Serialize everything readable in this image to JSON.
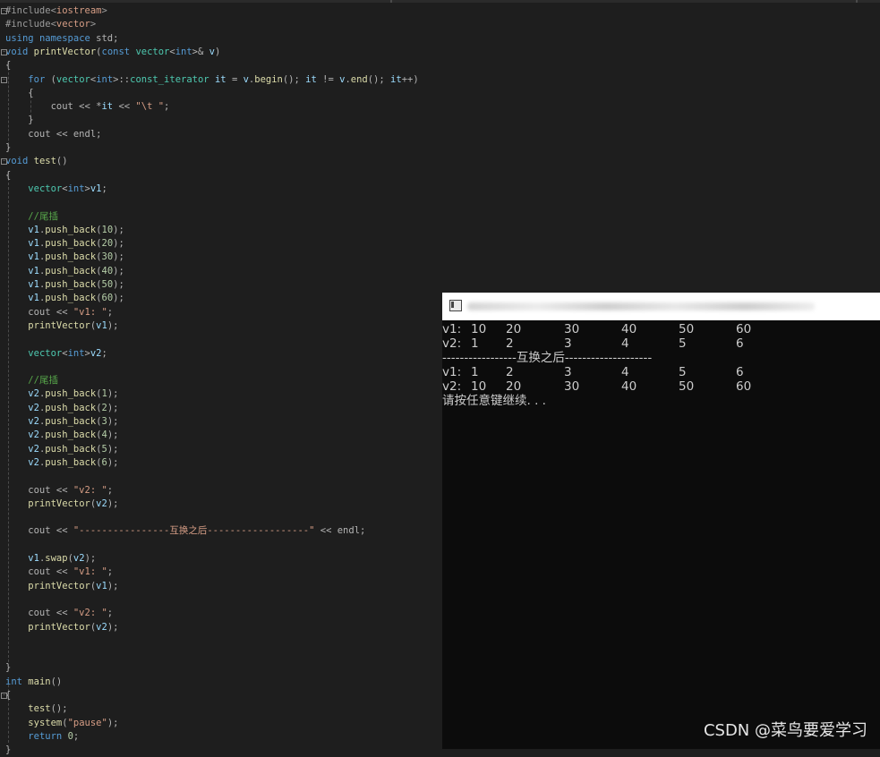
{
  "editor": {
    "code": [
      {
        "t": "pp",
        "v": "#include<"
      },
      {
        "t": "inc",
        "v": "iostream"
      },
      {
        "t": "pp",
        "v": ">"
      }
    ]
  },
  "lines": [
    [
      [
        "pp",
        "#include<"
      ],
      [
        "inc",
        "iostream"
      ],
      [
        "pp",
        ">"
      ]
    ],
    [
      [
        "pp",
        "#include<"
      ],
      [
        "inc",
        "vector"
      ],
      [
        "pp",
        ">"
      ]
    ],
    [
      [
        "kw",
        "using"
      ],
      [
        "op",
        " "
      ],
      [
        "kw",
        "namespace"
      ],
      [
        "op",
        " std;"
      ]
    ],
    [
      [
        "kw",
        "void"
      ],
      [
        "op",
        " "
      ],
      [
        "fn",
        "printVector"
      ],
      [
        "op",
        "("
      ],
      [
        "kw",
        "const"
      ],
      [
        "op",
        " "
      ],
      [
        "ty",
        "vector"
      ],
      [
        "op",
        "<"
      ],
      [
        "kw",
        "int"
      ],
      [
        "op",
        ">& "
      ],
      [
        "var",
        "v"
      ],
      [
        "op",
        ")"
      ]
    ],
    [
      [
        "op",
        "{"
      ]
    ],
    [
      [
        "op",
        "    "
      ],
      [
        "kw",
        "for"
      ],
      [
        "op",
        " ("
      ],
      [
        "ty",
        "vector"
      ],
      [
        "op",
        "<"
      ],
      [
        "kw",
        "int"
      ],
      [
        "op",
        ">::"
      ],
      [
        "ty",
        "const_iterator"
      ],
      [
        "op",
        " "
      ],
      [
        "var",
        "it"
      ],
      [
        "op",
        " = "
      ],
      [
        "var",
        "v"
      ],
      [
        "op",
        "."
      ],
      [
        "fn",
        "begin"
      ],
      [
        "op",
        "(); "
      ],
      [
        "var",
        "it"
      ],
      [
        "op",
        " != "
      ],
      [
        "var",
        "v"
      ],
      [
        "op",
        "."
      ],
      [
        "fn",
        "end"
      ],
      [
        "op",
        "(); "
      ],
      [
        "var",
        "it"
      ],
      [
        "op",
        "++)"
      ]
    ],
    [
      [
        "op",
        "    {"
      ]
    ],
    [
      [
        "op",
        "        cout << *"
      ],
      [
        "var",
        "it"
      ],
      [
        "op",
        " << "
      ],
      [
        "str",
        "\"\\t \""
      ],
      [
        "op",
        ";"
      ]
    ],
    [
      [
        "op",
        "    }"
      ]
    ],
    [
      [
        "op",
        "    cout << endl;"
      ]
    ],
    [
      [
        "op",
        "}"
      ]
    ],
    [
      [
        "kw",
        "void"
      ],
      [
        "op",
        " "
      ],
      [
        "fn",
        "test"
      ],
      [
        "op",
        "()"
      ]
    ],
    [
      [
        "op",
        "{"
      ]
    ],
    [
      [
        "op",
        "    "
      ],
      [
        "ty",
        "vector"
      ],
      [
        "op",
        "<"
      ],
      [
        "kw",
        "int"
      ],
      [
        "op",
        ">"
      ],
      [
        "var",
        "v1"
      ],
      [
        "op",
        ";"
      ]
    ],
    [
      [
        "op",
        ""
      ]
    ],
    [
      [
        "op",
        "    "
      ],
      [
        "cm",
        "//尾插"
      ]
    ],
    [
      [
        "op",
        "    "
      ],
      [
        "var",
        "v1"
      ],
      [
        "op",
        "."
      ],
      [
        "fn",
        "push_back"
      ],
      [
        "op",
        "("
      ],
      [
        "num",
        "10"
      ],
      [
        "op",
        ");"
      ]
    ],
    [
      [
        "op",
        "    "
      ],
      [
        "var",
        "v1"
      ],
      [
        "op",
        "."
      ],
      [
        "fn",
        "push_back"
      ],
      [
        "op",
        "("
      ],
      [
        "num",
        "20"
      ],
      [
        "op",
        ");"
      ]
    ],
    [
      [
        "op",
        "    "
      ],
      [
        "var",
        "v1"
      ],
      [
        "op",
        "."
      ],
      [
        "fn",
        "push_back"
      ],
      [
        "op",
        "("
      ],
      [
        "num",
        "30"
      ],
      [
        "op",
        ");"
      ]
    ],
    [
      [
        "op",
        "    "
      ],
      [
        "var",
        "v1"
      ],
      [
        "op",
        "."
      ],
      [
        "fn",
        "push_back"
      ],
      [
        "op",
        "("
      ],
      [
        "num",
        "40"
      ],
      [
        "op",
        ");"
      ]
    ],
    [
      [
        "op",
        "    "
      ],
      [
        "var",
        "v1"
      ],
      [
        "op",
        "."
      ],
      [
        "fn",
        "push_back"
      ],
      [
        "op",
        "("
      ],
      [
        "num",
        "50"
      ],
      [
        "op",
        ");"
      ]
    ],
    [
      [
        "op",
        "    "
      ],
      [
        "var",
        "v1"
      ],
      [
        "op",
        "."
      ],
      [
        "fn",
        "push_back"
      ],
      [
        "op",
        "("
      ],
      [
        "num",
        "60"
      ],
      [
        "op",
        ");"
      ]
    ],
    [
      [
        "op",
        "    cout << "
      ],
      [
        "str",
        "\"v1: \""
      ],
      [
        "op",
        ";"
      ]
    ],
    [
      [
        "op",
        "    "
      ],
      [
        "fn",
        "printVector"
      ],
      [
        "op",
        "("
      ],
      [
        "var",
        "v1"
      ],
      [
        "op",
        ");"
      ]
    ],
    [
      [
        "op",
        ""
      ]
    ],
    [
      [
        "op",
        "    "
      ],
      [
        "ty",
        "vector"
      ],
      [
        "op",
        "<"
      ],
      [
        "kw",
        "int"
      ],
      [
        "op",
        ">"
      ],
      [
        "var",
        "v2"
      ],
      [
        "op",
        ";"
      ]
    ],
    [
      [
        "op",
        ""
      ]
    ],
    [
      [
        "op",
        "    "
      ],
      [
        "cm",
        "//尾插"
      ]
    ],
    [
      [
        "op",
        "    "
      ],
      [
        "var",
        "v2"
      ],
      [
        "op",
        "."
      ],
      [
        "fn",
        "push_back"
      ],
      [
        "op",
        "("
      ],
      [
        "num",
        "1"
      ],
      [
        "op",
        ");"
      ]
    ],
    [
      [
        "op",
        "    "
      ],
      [
        "var",
        "v2"
      ],
      [
        "op",
        "."
      ],
      [
        "fn",
        "push_back"
      ],
      [
        "op",
        "("
      ],
      [
        "num",
        "2"
      ],
      [
        "op",
        ");"
      ]
    ],
    [
      [
        "op",
        "    "
      ],
      [
        "var",
        "v2"
      ],
      [
        "op",
        "."
      ],
      [
        "fn",
        "push_back"
      ],
      [
        "op",
        "("
      ],
      [
        "num",
        "3"
      ],
      [
        "op",
        ");"
      ]
    ],
    [
      [
        "op",
        "    "
      ],
      [
        "var",
        "v2"
      ],
      [
        "op",
        "."
      ],
      [
        "fn",
        "push_back"
      ],
      [
        "op",
        "("
      ],
      [
        "num",
        "4"
      ],
      [
        "op",
        ");"
      ]
    ],
    [
      [
        "op",
        "    "
      ],
      [
        "var",
        "v2"
      ],
      [
        "op",
        "."
      ],
      [
        "fn",
        "push_back"
      ],
      [
        "op",
        "("
      ],
      [
        "num",
        "5"
      ],
      [
        "op",
        ");"
      ]
    ],
    [
      [
        "op",
        "    "
      ],
      [
        "var",
        "v2"
      ],
      [
        "op",
        "."
      ],
      [
        "fn",
        "push_back"
      ],
      [
        "op",
        "("
      ],
      [
        "num",
        "6"
      ],
      [
        "op",
        ");"
      ]
    ],
    [
      [
        "op",
        ""
      ]
    ],
    [
      [
        "op",
        "    cout << "
      ],
      [
        "str",
        "\"v2: \""
      ],
      [
        "op",
        ";"
      ]
    ],
    [
      [
        "op",
        "    "
      ],
      [
        "fn",
        "printVector"
      ],
      [
        "op",
        "("
      ],
      [
        "var",
        "v2"
      ],
      [
        "op",
        ");"
      ]
    ],
    [
      [
        "op",
        ""
      ]
    ],
    [
      [
        "op",
        "    cout << "
      ],
      [
        "str",
        "\"----------------互换之后------------------\""
      ],
      [
        "op",
        " << endl;"
      ]
    ],
    [
      [
        "op",
        ""
      ]
    ],
    [
      [
        "op",
        "    "
      ],
      [
        "var",
        "v1"
      ],
      [
        "op",
        "."
      ],
      [
        "fn",
        "swap"
      ],
      [
        "op",
        "("
      ],
      [
        "var",
        "v2"
      ],
      [
        "op",
        ");"
      ]
    ],
    [
      [
        "op",
        "    cout << "
      ],
      [
        "str",
        "\"v1: \""
      ],
      [
        "op",
        ";"
      ]
    ],
    [
      [
        "op",
        "    "
      ],
      [
        "fn",
        "printVector"
      ],
      [
        "op",
        "("
      ],
      [
        "var",
        "v1"
      ],
      [
        "op",
        ");"
      ]
    ],
    [
      [
        "op",
        ""
      ]
    ],
    [
      [
        "op",
        "    cout << "
      ],
      [
        "str",
        "\"v2: \""
      ],
      [
        "op",
        ";"
      ]
    ],
    [
      [
        "op",
        "    "
      ],
      [
        "fn",
        "printVector"
      ],
      [
        "op",
        "("
      ],
      [
        "var",
        "v2"
      ],
      [
        "op",
        ");"
      ]
    ],
    [
      [
        "op",
        ""
      ]
    ],
    [
      [
        "op",
        ""
      ]
    ],
    [
      [
        "op",
        "}"
      ]
    ],
    [
      [
        "kw",
        "int"
      ],
      [
        "op",
        " "
      ],
      [
        "fn",
        "main"
      ],
      [
        "op",
        "()"
      ]
    ],
    [
      [
        "op",
        "{"
      ]
    ],
    [
      [
        "op",
        "    "
      ],
      [
        "fn",
        "test"
      ],
      [
        "op",
        "();"
      ]
    ],
    [
      [
        "op",
        "    "
      ],
      [
        "fn",
        "system"
      ],
      [
        "op",
        "("
      ],
      [
        "str",
        "\"pause\""
      ],
      [
        "op",
        ");"
      ]
    ],
    [
      [
        "op",
        "    "
      ],
      [
        "kw",
        "return"
      ],
      [
        "op",
        " "
      ],
      [
        "num",
        "0"
      ],
      [
        "op",
        ";"
      ]
    ],
    [
      [
        "op",
        "}"
      ]
    ]
  ],
  "console": {
    "rows": [
      {
        "label": "v1:",
        "values": [
          "10",
          "20",
          "30",
          "40",
          "50",
          "60"
        ]
      },
      {
        "label": "v2:",
        "values": [
          "1",
          "2",
          "3",
          "4",
          "5",
          "6"
        ]
      },
      {
        "text": "-----------------互换之后--------------------"
      },
      {
        "label": "v1:",
        "values": [
          "1",
          "2",
          "3",
          "4",
          "5",
          "6"
        ]
      },
      {
        "label": "v2:",
        "values": [
          "10",
          "20",
          "30",
          "40",
          "50",
          "60"
        ]
      },
      {
        "text": "请按任意键继续. . ."
      }
    ]
  },
  "watermark": "CSDN @菜鸟要爱学习"
}
